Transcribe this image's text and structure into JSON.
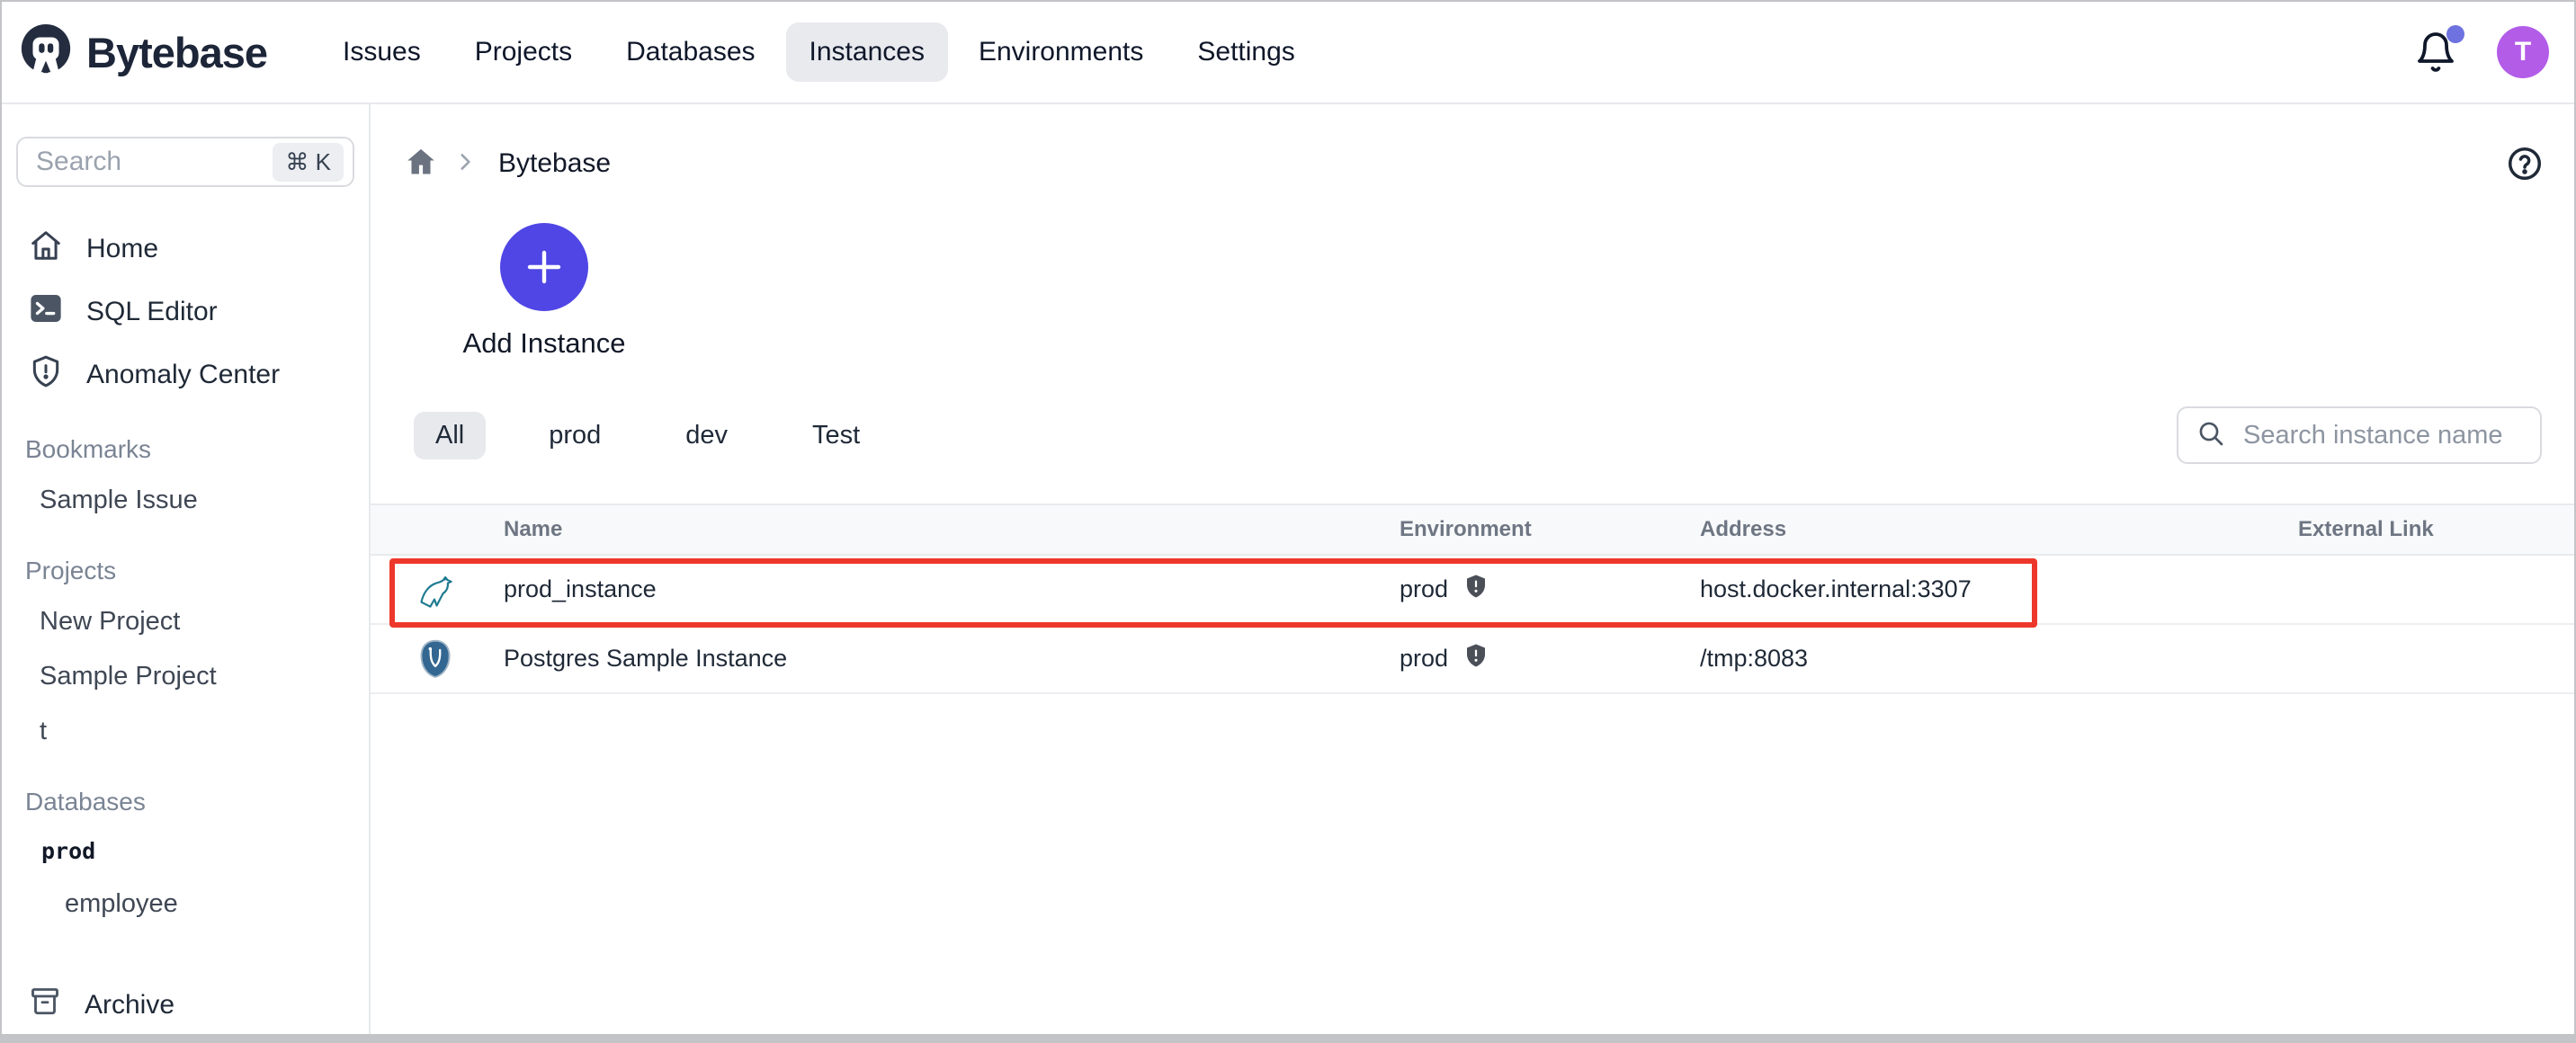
{
  "navbar": {
    "brand": "Bytebase",
    "links": [
      {
        "label": "Issues"
      },
      {
        "label": "Projects"
      },
      {
        "label": "Databases"
      },
      {
        "label": "Instances"
      },
      {
        "label": "Environments"
      },
      {
        "label": "Settings"
      }
    ],
    "active_link": "Instances",
    "notification_dot": true,
    "avatar_text": "T"
  },
  "sidebar": {
    "search": {
      "placeholder": "Search",
      "shortcut": "⌘ K"
    },
    "nav": [
      {
        "icon": "home-icon",
        "label": "Home"
      },
      {
        "icon": "terminal-icon",
        "label": "SQL Editor"
      },
      {
        "icon": "shield-alert-icon",
        "label": "Anomaly Center"
      }
    ],
    "sections": [
      {
        "title": "Bookmarks",
        "items": [
          {
            "label": "Sample Issue"
          }
        ]
      },
      {
        "title": "Projects",
        "items": [
          {
            "label": "New Project"
          },
          {
            "label": "Sample Project"
          },
          {
            "label": "t"
          }
        ]
      },
      {
        "title": "Databases",
        "items": [
          {
            "label": "prod"
          },
          {
            "label": "employee"
          }
        ]
      }
    ],
    "archive_label": "Archive"
  },
  "main": {
    "breadcrumb": {
      "current": "Bytebase"
    },
    "add_instance_label": "Add Instance",
    "filters": [
      {
        "label": "All"
      },
      {
        "label": "prod"
      },
      {
        "label": "dev"
      },
      {
        "label": "Test"
      }
    ],
    "active_filter": "All",
    "search_placeholder": "Search instance name",
    "table": {
      "columns": [
        "Name",
        "Environment",
        "Address",
        "External Link"
      ],
      "rows": [
        {
          "engine": "mysql-icon",
          "name": "prod_instance",
          "environment": "prod",
          "address": "host.docker.internal:3307",
          "external_link": "",
          "highlighted": true
        },
        {
          "engine": "postgres-icon",
          "name": "Postgres Sample Instance",
          "environment": "prod",
          "address": "/tmp:8083",
          "external_link": "",
          "highlighted": false
        }
      ]
    }
  },
  "colors": {
    "accent_indigo": "#4f46e5",
    "avatar_purple": "#b35ce8",
    "notification_badge": "#6d72e0",
    "highlight_red": "#ee372b",
    "active_pill_gray": "#e8eaee",
    "mysql_teal": "#1f7a90",
    "postgres_blue": "#336791"
  }
}
